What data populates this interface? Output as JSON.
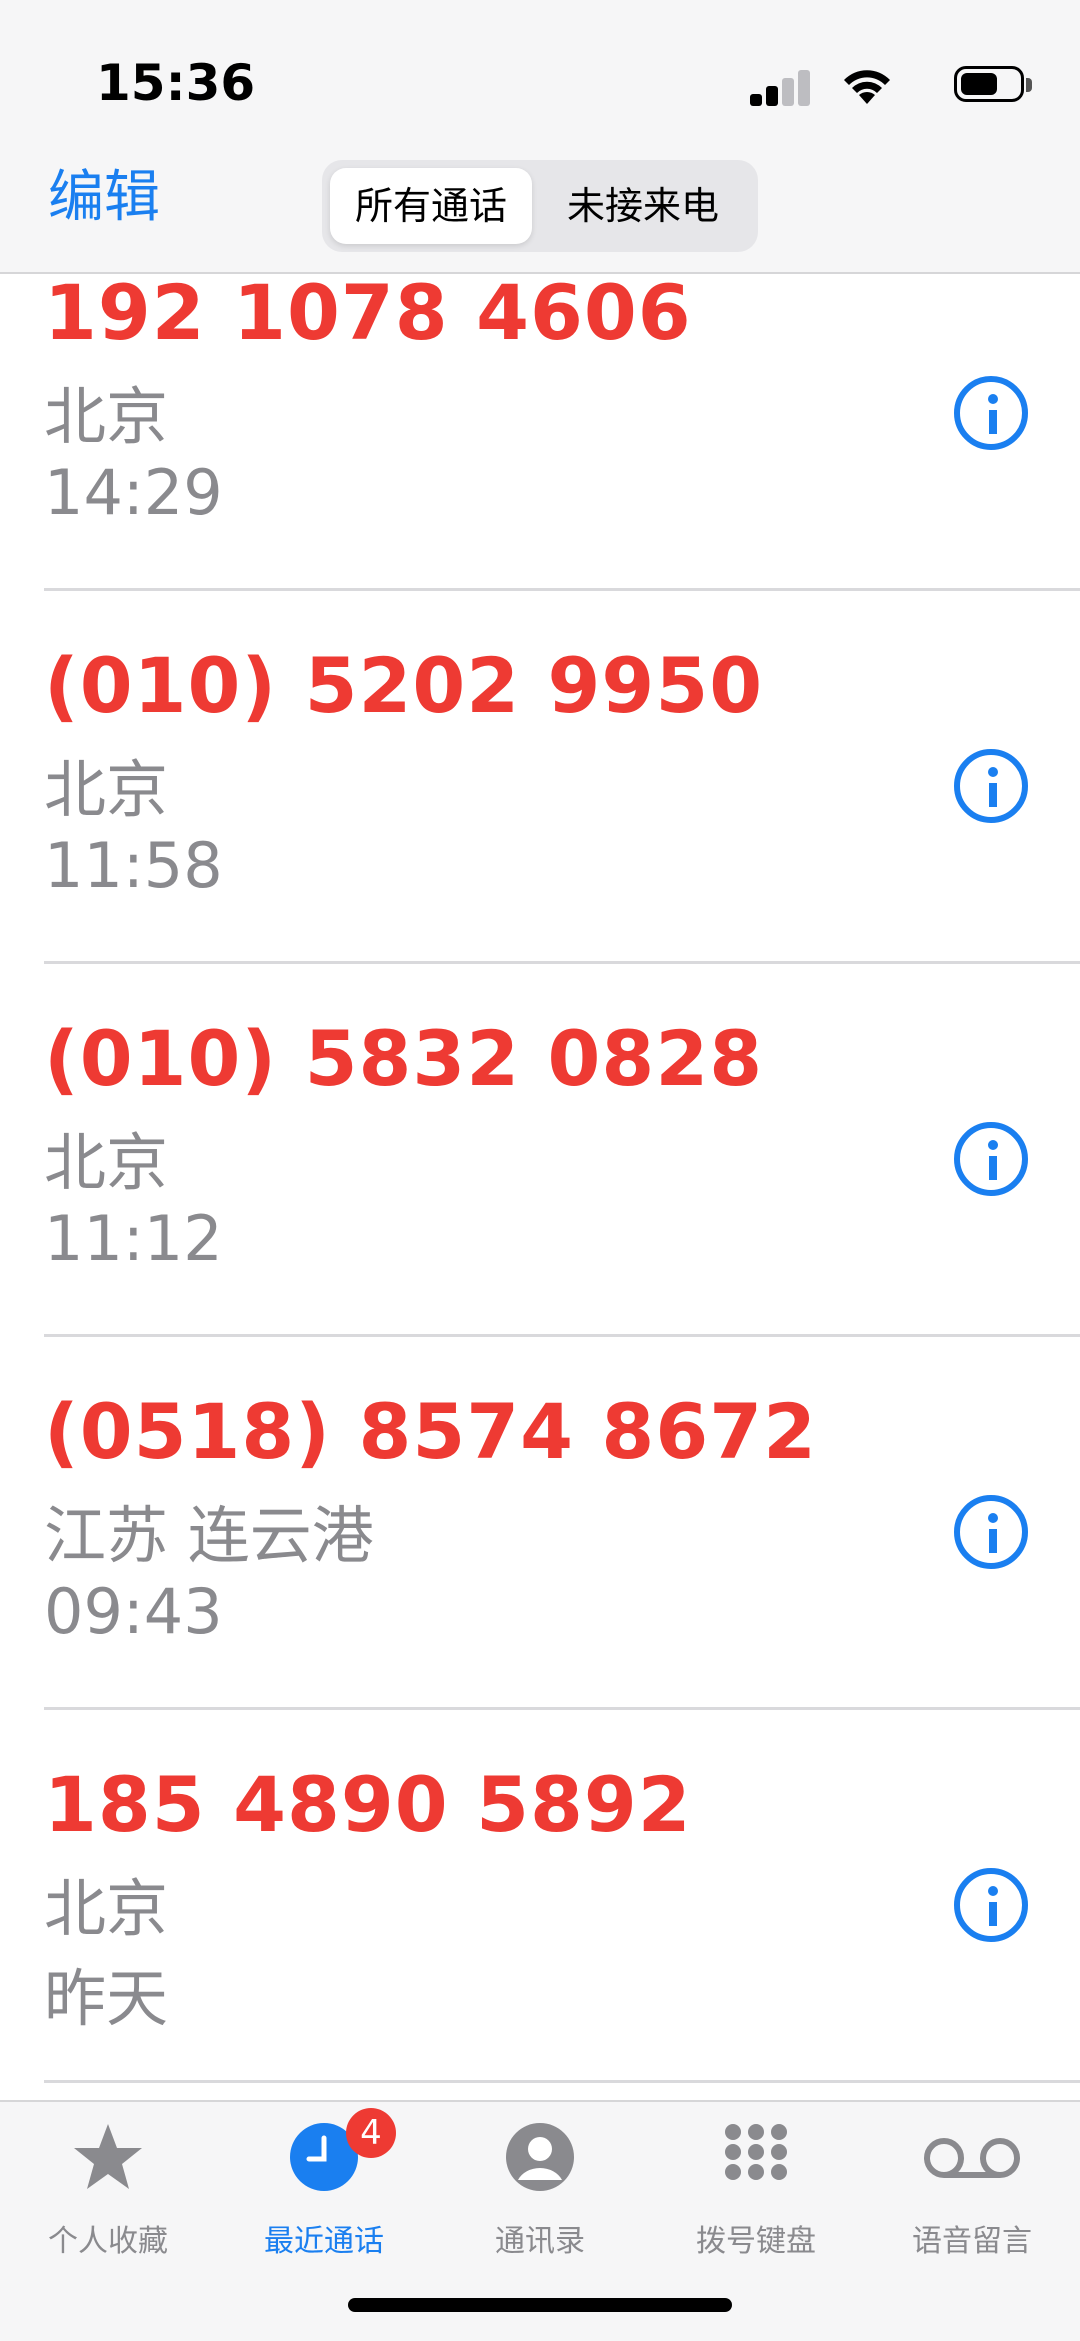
{
  "status_bar": {
    "time": "15:36"
  },
  "nav": {
    "edit_label": "编辑",
    "segments": [
      {
        "label": "所有通话",
        "selected": true
      },
      {
        "label": "未接来电",
        "selected": false
      }
    ]
  },
  "calls": [
    {
      "number": "192 1078 4606",
      "location": "北京",
      "time": "14:29",
      "missed": true
    },
    {
      "number": "(010) 5202 9950",
      "location": "北京",
      "time": "11:58",
      "missed": true
    },
    {
      "number": "(010) 5832 0828",
      "location": "北京",
      "time": "11:12",
      "missed": true
    },
    {
      "number": "(0518) 8574 8672",
      "location": "江苏 连云港",
      "time": "09:43",
      "missed": true
    },
    {
      "number": "185 4890 5892",
      "location": "北京",
      "time": "昨天",
      "missed": true
    }
  ],
  "tabbar": {
    "items": [
      {
        "label": "个人收藏",
        "icon": "star-icon"
      },
      {
        "label": "最近通话",
        "icon": "clock-icon",
        "badge": "4",
        "active": true
      },
      {
        "label": "通讯录",
        "icon": "person-icon"
      },
      {
        "label": "拨号键盘",
        "icon": "keypad-icon"
      },
      {
        "label": "语音留言",
        "icon": "voicemail-icon"
      }
    ]
  },
  "colors": {
    "accent": "#1a7ff0",
    "missed": "#ee3a33",
    "secondary_text": "#8a8a8e"
  }
}
